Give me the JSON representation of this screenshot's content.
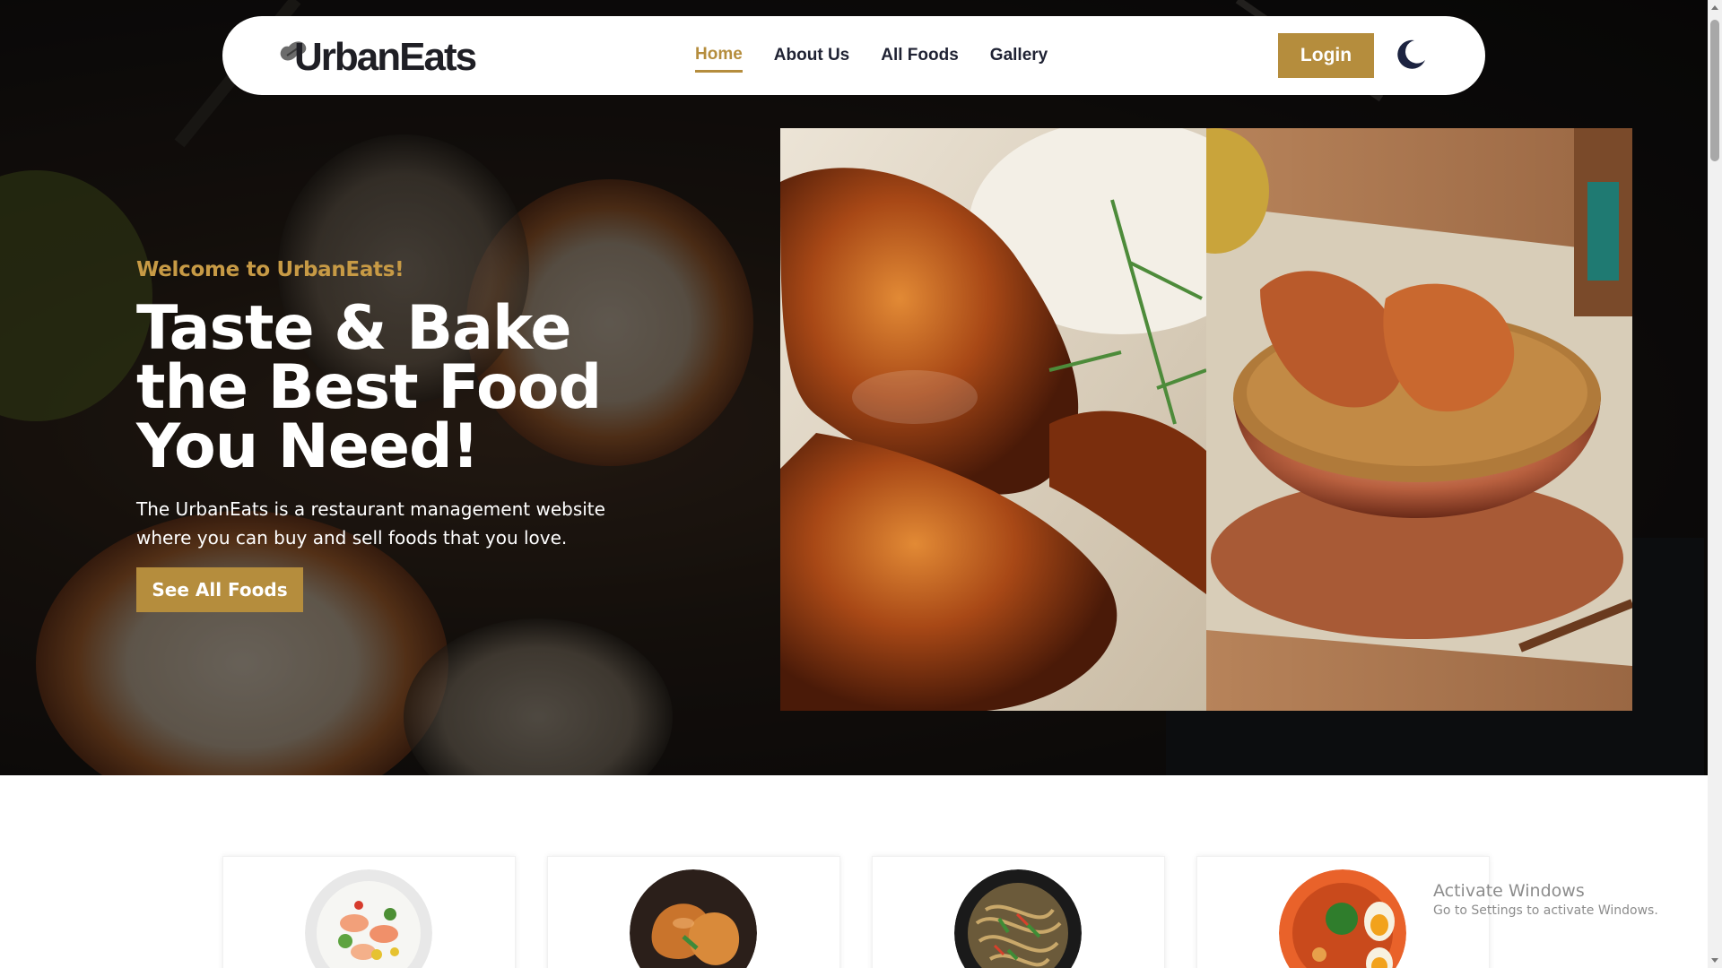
{
  "brand": {
    "name": "UrbanEats",
    "logo_icon": "peanut-icon"
  },
  "nav": {
    "links": [
      {
        "label": "Home",
        "active": true
      },
      {
        "label": "About Us",
        "active": false
      },
      {
        "label": "All Foods",
        "active": false
      },
      {
        "label": "Gallery",
        "active": false
      }
    ],
    "login_label": "Login",
    "theme_icon": "moon-icon"
  },
  "hero": {
    "welcome": "Welcome to UrbanEats!",
    "headline": "Taste & Bake the Best Food You Need!",
    "description": "The UrbanEats is a restaurant management website where you can buy and sell foods that you love.",
    "cta_label": "See All Foods",
    "images": [
      "glazed-chicken-drumsticks-with-rice",
      "chicken-biryani-in-copper-bowl"
    ]
  },
  "categories": [
    {
      "image": "shrimp-vegetable-salad"
    },
    {
      "image": "roast-chicken-pieces"
    },
    {
      "image": "stir-fried-noodles"
    },
    {
      "image": "ramen-with-egg"
    }
  ],
  "system": {
    "watermark_title": "Activate Windows",
    "watermark_subtitle": "Go to Settings to activate Windows."
  },
  "colors": {
    "accent": "#b58d3d",
    "welcome": "#c79a45",
    "dark": "#1f1f25"
  }
}
